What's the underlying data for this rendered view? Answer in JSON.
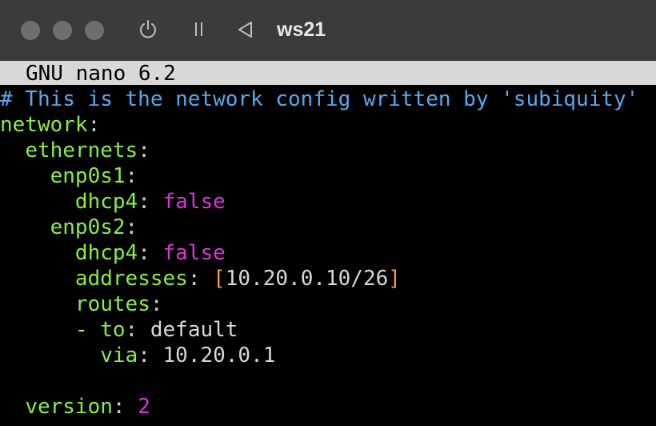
{
  "window": {
    "title": "ws21"
  },
  "toolbar": {
    "icons": [
      "power-icon",
      "pause-icon",
      "back-icon"
    ]
  },
  "editor": {
    "app_label": "GNU nano 6.2",
    "lines": {
      "l1": "# This is the network config written by 'subiquity'",
      "l2_key": "network",
      "l3_key": "ethernets",
      "l4_key": "enp0s1",
      "l5_key": "dhcp4",
      "l5_val": "false",
      "l6_key": "enp0s2",
      "l7_key": "dhcp4",
      "l7_val": "false",
      "l8_key": "addresses",
      "l8_open": "[",
      "l8_val": "10.20.0.10/26",
      "l8_close": "]",
      "l9_key": "routes",
      "l10_dash": "-",
      "l10_key": "to",
      "l10_val": "default",
      "l11_key": "via",
      "l11_val": "10.20.0.1",
      "l13_key": "version",
      "l13_val": "2"
    }
  },
  "colors": {
    "comment": "#55aaee",
    "key": "#88ee44",
    "boolean": "#dd33dd",
    "bracket": "#f0a030",
    "titlebar": "#3b3b3d"
  }
}
